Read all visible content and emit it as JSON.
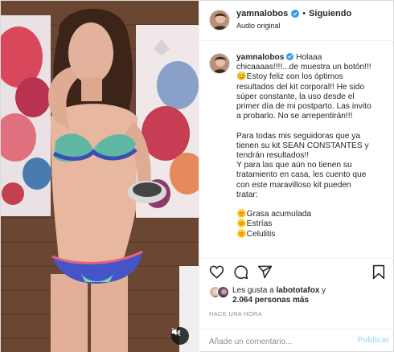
{
  "header": {
    "username": "yamnalobos",
    "separator": "•",
    "follow_label": "Siguiendo",
    "audio_label": "Audio original"
  },
  "caption": {
    "username": "yamnalobos",
    "lines": [
      "Holaaa",
      "chicaaaas!!!!...de muestra un botón!!!",
      "😊Estoy feliz con los óptimos",
      "resultados del kit corporal!! He sido",
      "súper constante, la uso desde el",
      "primer día de mi postparto. Las invito",
      "a probarlo. No se arrepentirán!!!",
      "",
      "Para todas mis seguidoras que ya",
      "tienen su kit SEAN CONSTANTES y",
      "tendrán resultados!!",
      "Y para las que aún no tienen su",
      "tratamiento en casa, les cuento que",
      "con este maravilloso kit pueden",
      "tratar:",
      "",
      "🌞Grasa acumulada",
      "🌞Estrías",
      "🌞Celulitis"
    ]
  },
  "likes": {
    "prefix": "Les gusta a",
    "user": "labototafox",
    "connector": "y",
    "count": "2.064 personas más"
  },
  "timestamp": "HACE UNA HORA",
  "comment_box": {
    "placeholder": "Añade un comentario...",
    "publish_label": "Publicar"
  },
  "icons": {
    "like": "heart-icon",
    "comment": "comment-icon",
    "share": "share-icon",
    "save": "bookmark-icon",
    "mute": "speaker-muted-icon",
    "verified": "verified-badge-icon"
  },
  "colors": {
    "verified_blue": "#3897f0",
    "publish_disabled": "#b2dffc",
    "meta_gray": "#8e8e8e"
  }
}
